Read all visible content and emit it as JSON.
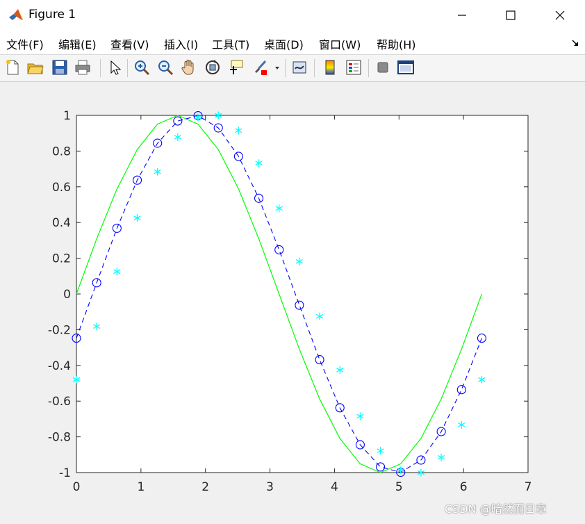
{
  "window": {
    "title": "Figure 1",
    "icon": "matlab-logo-icon",
    "controls": [
      "minimize-icon",
      "maximize-icon",
      "close-icon"
    ]
  },
  "menu": {
    "items": [
      "文件(F)",
      "编辑(E)",
      "查看(V)",
      "插入(I)",
      "工具(T)",
      "桌面(D)",
      "窗口(W)",
      "帮助(H)"
    ]
  },
  "toolbar": {
    "icons": [
      "new-figure-icon",
      "open-file-icon",
      "save-icon",
      "print-icon",
      "select-arrow-icon",
      "zoom-in-icon",
      "zoom-out-icon",
      "pan-hand-icon",
      "rotate-3d-icon",
      "data-cursor-icon",
      "brush-icon",
      "link-plot-icon",
      "colorbar-icon",
      "legend-icon",
      "hide-plot-tools-icon",
      "show-plot-tools-icon"
    ]
  },
  "watermark": "CSDN @暗然而日章",
  "colors": {
    "green_line": "#00ff00",
    "blue_line": "#0000ff",
    "cyan_star": "#00ffff",
    "axes_bg": "#ffffff",
    "figure_bg": "#f0f0f0"
  },
  "chart_data": {
    "type": "line",
    "title": "",
    "xlabel": "",
    "ylabel": "",
    "xlim": [
      0,
      7
    ],
    "ylim": [
      -1,
      1
    ],
    "xticks": [
      "0",
      "1",
      "2",
      "3",
      "4",
      "5",
      "6",
      "7"
    ],
    "yticks": [
      "-1",
      "-0.8",
      "-0.6",
      "-0.4",
      "-0.2",
      "0",
      "0.2",
      "0.4",
      "0.6",
      "0.8",
      "1"
    ],
    "grid": false,
    "legend": "none",
    "x": [
      0,
      0.3142,
      0.6283,
      0.9425,
      1.2566,
      1.5708,
      1.885,
      2.1991,
      2.5133,
      2.8274,
      3.1416,
      3.4558,
      3.7699,
      4.0841,
      4.3982,
      4.7124,
      5.0265,
      5.3407,
      5.6549,
      5.969,
      6.2832
    ],
    "series": [
      {
        "style": "green solid line",
        "color": "#00ff00",
        "values": [
          0,
          0.309,
          0.5878,
          0.809,
          0.9511,
          1,
          0.9511,
          0.809,
          0.5878,
          0.309,
          0,
          -0.309,
          -0.5878,
          -0.809,
          -0.9511,
          -1,
          -0.9511,
          -0.809,
          -0.5878,
          -0.309,
          0
        ]
      },
      {
        "style": "blue dashed line with circle markers",
        "color": "#0000ff",
        "values": [
          -0.2474,
          0.0628,
          0.3681,
          0.6374,
          0.8443,
          0.9686,
          0.998,
          0.9298,
          0.7705,
          0.5358,
          0.2474,
          -0.0628,
          -0.3681,
          -0.6374,
          -0.8443,
          -0.9686,
          -0.998,
          -0.9298,
          -0.7705,
          -0.5358,
          -0.2474
        ]
      },
      {
        "style": "cyan asterisk markers",
        "color": "#00ffff",
        "values": [
          -0.4794,
          -0.1822,
          0.1253,
          0.4258,
          0.6845,
          0.8776,
          0.9877,
          1.0,
          0.9152,
          0.7327,
          0.4794,
          0.1822,
          -0.1253,
          -0.4258,
          -0.6845,
          -0.8776,
          -0.9877,
          -1.0,
          -0.9152,
          -0.7327,
          -0.4794
        ]
      }
    ]
  }
}
